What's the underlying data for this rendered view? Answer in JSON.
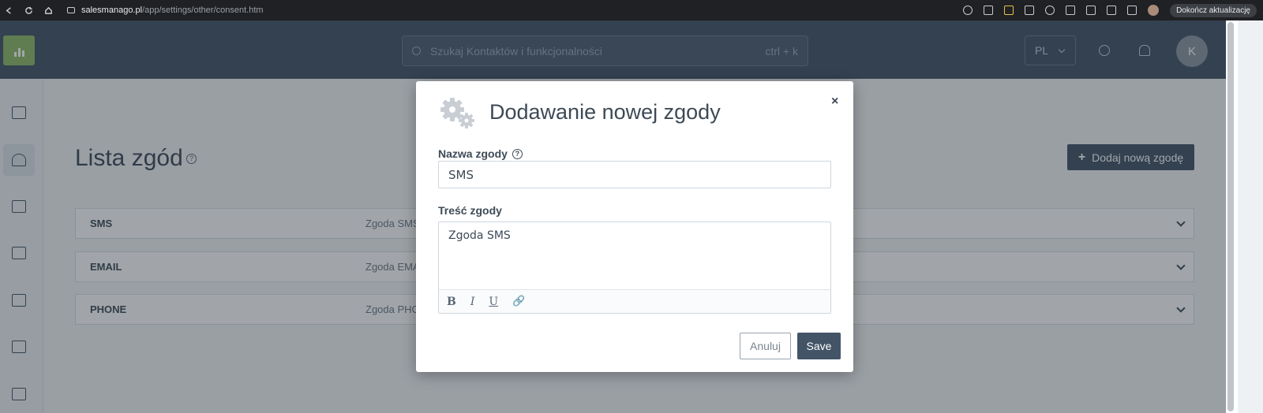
{
  "browser": {
    "url_host": "salesmanago.pl",
    "url_path": "/app/settings/other/consent.htm",
    "update_button": "Dokończ aktualizację"
  },
  "header": {
    "search_placeholder": "Szukaj Kontaktów i funkcjonalności",
    "search_shortcut": "ctrl + k",
    "language": "PL",
    "user_initial": "K"
  },
  "page": {
    "title": "Lista zgód",
    "add_button": "Dodaj nową zgodę",
    "consents": [
      {
        "name": "SMS",
        "description": "Zgoda SMS"
      },
      {
        "name": "EMAIL",
        "description": "Zgoda EMA"
      },
      {
        "name": "PHONE",
        "description": "Zgoda PHO"
      }
    ]
  },
  "modal": {
    "title": "Dodawanie nowej zgody",
    "close_label": "×",
    "name_label": "Nazwa zgody",
    "name_value": "SMS",
    "content_label": "Treść zgody",
    "content_value": "Zgoda SMS",
    "toolbar": {
      "bold": "B",
      "italic": "I",
      "underline": "U",
      "link": "🔗"
    },
    "cancel_label": "Anuluj",
    "save_label": "Save"
  },
  "colors": {
    "header_bg": "#435466",
    "accent_green": "#8dbb67",
    "primary_button": "#435466"
  }
}
